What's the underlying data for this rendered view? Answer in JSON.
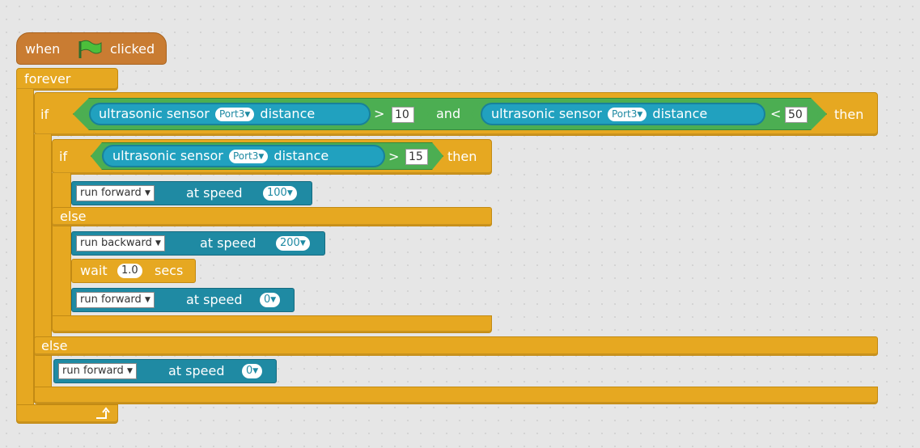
{
  "hat": {
    "when": "when",
    "clicked": "clicked"
  },
  "forever": {
    "label": "forever"
  },
  "if_outer": {
    "if": "if",
    "sensor_left": {
      "label": "ultrasonic sensor",
      "port": "Port3",
      "distance": "distance",
      "op": ">",
      "value": "10"
    },
    "and": "and",
    "sensor_right": {
      "label": "ultrasonic sensor",
      "port": "Port3",
      "distance": "distance",
      "op": "<",
      "value": "50"
    },
    "then": "then",
    "else": "else"
  },
  "if_inner": {
    "if": "if",
    "sensor": {
      "label": "ultrasonic sensor",
      "port": "Port3",
      "distance": "distance",
      "op": ">",
      "value": "15"
    },
    "then": "then",
    "else": "else"
  },
  "blocks": {
    "run1": {
      "dir": "run forward",
      "at": "at speed",
      "speed": "100"
    },
    "run2": {
      "dir": "run backward",
      "at": "at speed",
      "speed": "200"
    },
    "wait": {
      "wait": "wait",
      "secs_value": "1.0",
      "secs": "secs"
    },
    "run3": {
      "dir": "run forward",
      "at": "at speed",
      "speed": "0"
    },
    "run4": {
      "dir": "run forward",
      "at": "at speed",
      "speed": "0"
    }
  },
  "icons": {
    "flag": "green-flag-icon",
    "loop_arrow": "loop-arrow-icon",
    "dropdown": "dropdown-triangle-icon"
  },
  "colors": {
    "events": "#c97c32",
    "control": "#e6a821",
    "sensing": "#21a1bf",
    "motion": "#1f8aa3",
    "operators": "#4cae52"
  }
}
